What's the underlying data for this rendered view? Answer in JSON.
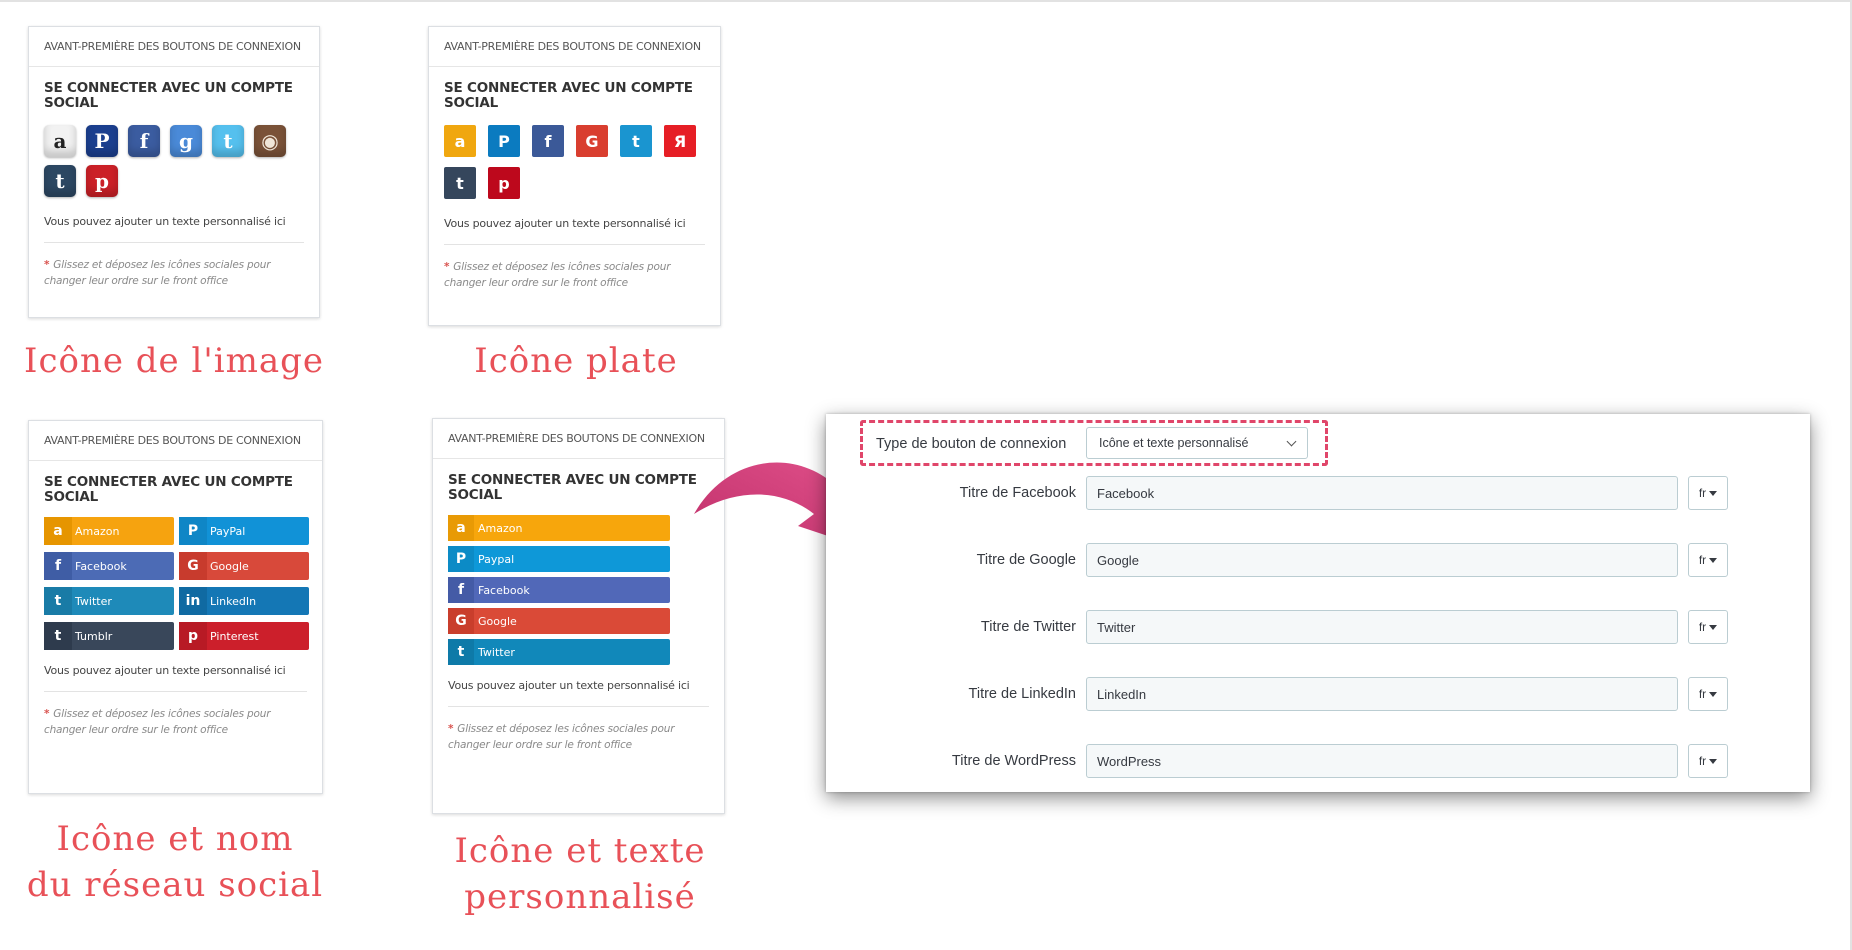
{
  "preview_header": "AVANT-PREMIÈRE DES BOUTONS DE CONNEXION",
  "preview_title": "SE CONNECTER AVEC UN COMPTE SOCIAL",
  "custom_text": "Vous pouvez ajouter un texte personnalisé ici",
  "drag_note": "Glissez et déposez les icônes sociales pour changer leur ordre sur le front office",
  "image_icons": [
    {
      "name": "amazon-icon",
      "glyph": "a",
      "color": "#f2f2f2",
      "text_color": "#222222"
    },
    {
      "name": "paypal-icon",
      "glyph": "P",
      "color": "#1b3f8f",
      "text_color": "#ffffff"
    },
    {
      "name": "facebook-icon",
      "glyph": "f",
      "color": "#3b5ca0",
      "text_color": "#ffffff"
    },
    {
      "name": "google-icon",
      "glyph": "g",
      "color": "#4a8ad8",
      "text_color": "#ffffff"
    },
    {
      "name": "twitter-icon",
      "glyph": "t",
      "color": "#55c0ee",
      "text_color": "#ffffff"
    },
    {
      "name": "instagram-icon",
      "glyph": "◉",
      "color": "#7a5238",
      "text_color": "#f0e6d8"
    },
    {
      "name": "tumblr-icon",
      "glyph": "t",
      "color": "#2c4762",
      "text_color": "#ffffff"
    },
    {
      "name": "pinterest-icon",
      "glyph": "p",
      "color": "#cb2027",
      "text_color": "#ffffff"
    }
  ],
  "flat_icons": [
    {
      "name": "amazon-icon",
      "glyph": "a",
      "color": "#f0a70f"
    },
    {
      "name": "paypal-icon",
      "glyph": "P",
      "color": "#0b7bc0"
    },
    {
      "name": "facebook-icon",
      "glyph": "f",
      "color": "#3b5998"
    },
    {
      "name": "google-icon",
      "glyph": "G",
      "color": "#d93e2f"
    },
    {
      "name": "twitter-icon",
      "glyph": "t",
      "color": "#1a95d0"
    },
    {
      "name": "yandex-icon",
      "glyph": "Я",
      "color": "#e61e25"
    },
    {
      "name": "tumblr-icon",
      "glyph": "t",
      "color": "#35465c"
    },
    {
      "name": "pinterest-icon",
      "glyph": "p",
      "color": "#bd081c"
    }
  ],
  "named_buttons": [
    {
      "name": "amazon",
      "label": "Amazon",
      "glyph": "a",
      "color": "#f6a30f",
      "icon_bg": "#e69500"
    },
    {
      "name": "paypal",
      "label": "PayPal",
      "glyph": "P",
      "color": "#1192d7",
      "icon_bg": "#0f86c6"
    },
    {
      "name": "facebook",
      "label": "Facebook",
      "glyph": "f",
      "color": "#4c6bb5",
      "icon_bg": "#3f5da5"
    },
    {
      "name": "google",
      "label": "Google",
      "glyph": "G",
      "color": "#d8493a",
      "icon_bg": "#c83b2d"
    },
    {
      "name": "twitter",
      "label": "Twitter",
      "glyph": "t",
      "color": "#1e8ab9",
      "icon_bg": "#197ba6"
    },
    {
      "name": "linkedin",
      "label": "LinkedIn",
      "glyph": "in",
      "color": "#1477b5",
      "icon_bg": "#106aa2"
    },
    {
      "name": "tumblr",
      "label": "Tumblr",
      "glyph": "t",
      "color": "#39475a",
      "icon_bg": "#2e3b4d"
    },
    {
      "name": "pinterest",
      "label": "Pinterest",
      "glyph": "p",
      "color": "#cc1f2b",
      "icon_bg": "#b81a25"
    }
  ],
  "custom_buttons": [
    {
      "name": "amazon",
      "label": "Amazon",
      "glyph": "a",
      "color": "#f7a60c",
      "icon_bg": "#e89a05"
    },
    {
      "name": "paypal",
      "label": "Paypal",
      "glyph": "P",
      "color": "#0e98d8",
      "icon_bg": "#0c8bc6"
    },
    {
      "name": "facebook",
      "label": "Facebook",
      "glyph": "f",
      "color": "#5168b8",
      "icon_bg": "#445ba6"
    },
    {
      "name": "google",
      "label": "Google",
      "glyph": "G",
      "color": "#da4a37",
      "icon_bg": "#c93e2c"
    },
    {
      "name": "twitter",
      "label": "Twitter",
      "glyph": "t",
      "color": "#1188ba",
      "icon_bg": "#0e7aa8"
    }
  ],
  "captions": {
    "image_icon": "Icône de l'image",
    "flat_icon": "Icône plate",
    "icon_name_line1": "Icône et nom",
    "icon_name_line2": "du réseau social",
    "icon_text_line1": "Icône et texte",
    "icon_text_line2": "personnalisé"
  },
  "settings": {
    "type_label": "Type de bouton de connexion",
    "type_value": "Icône et texte personnalisé",
    "fields": [
      {
        "label": "Titre de Facebook",
        "value": "Facebook",
        "lang": "fr"
      },
      {
        "label": "Titre de Google",
        "value": "Google",
        "lang": "fr"
      },
      {
        "label": "Titre de Twitter",
        "value": "Twitter",
        "lang": "fr"
      },
      {
        "label": "Titre de LinkedIn",
        "value": "LinkedIn",
        "lang": "fr"
      },
      {
        "label": "Titre de WordPress",
        "value": "WordPress",
        "lang": "fr"
      }
    ]
  },
  "colors": {
    "caption": "#e85158",
    "highlight_dash": "#e0466a",
    "arrow": "#c0306a"
  }
}
